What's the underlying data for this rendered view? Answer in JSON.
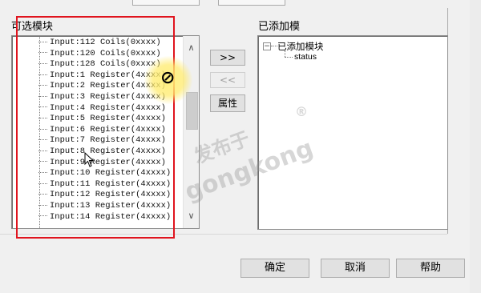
{
  "available_modules": {
    "label": "可选模块",
    "items": [
      "Input:112 Coils(0xxxx)",
      "Input:120 Coils(0xxxx)",
      "Input:128 Coils(0xxxx)",
      "Input:1 Register(4xxxx)",
      "Input:2 Register(4xxxx)",
      "Input:3 Register(4xxxx)",
      "Input:4 Register(4xxxx)",
      "Input:5 Register(4xxxx)",
      "Input:6 Register(4xxxx)",
      "Input:7 Register(4xxxx)",
      "Input:8 Register(4xxxx)",
      "Input:9 Register(4xxxx)",
      "Input:10 Register(4xxxx)",
      "Input:11 Register(4xxxx)",
      "Input:12 Register(4xxxx)",
      "Input:13 Register(4xxxx)",
      "Input:14 Register(4xxxx)"
    ]
  },
  "middle_buttons": {
    "add": ">>",
    "remove": "<<",
    "properties": "属性"
  },
  "added_modules": {
    "label": "已添加模",
    "root": "已添加模块",
    "root_expander": "−",
    "child": "status"
  },
  "footer": {
    "ok": "确定",
    "cancel": "取消",
    "help": "帮助"
  },
  "watermark": {
    "line1": "发布于",
    "line2": "gongkong",
    "mark": "®"
  },
  "icons": {
    "scroll_up": "up-arrow",
    "scroll_down": "down-arrow",
    "cursor": "no-entry-cursor"
  },
  "colors": {
    "annotation_red": "#e0141e",
    "cursor_halo": "#ffeb6e"
  }
}
